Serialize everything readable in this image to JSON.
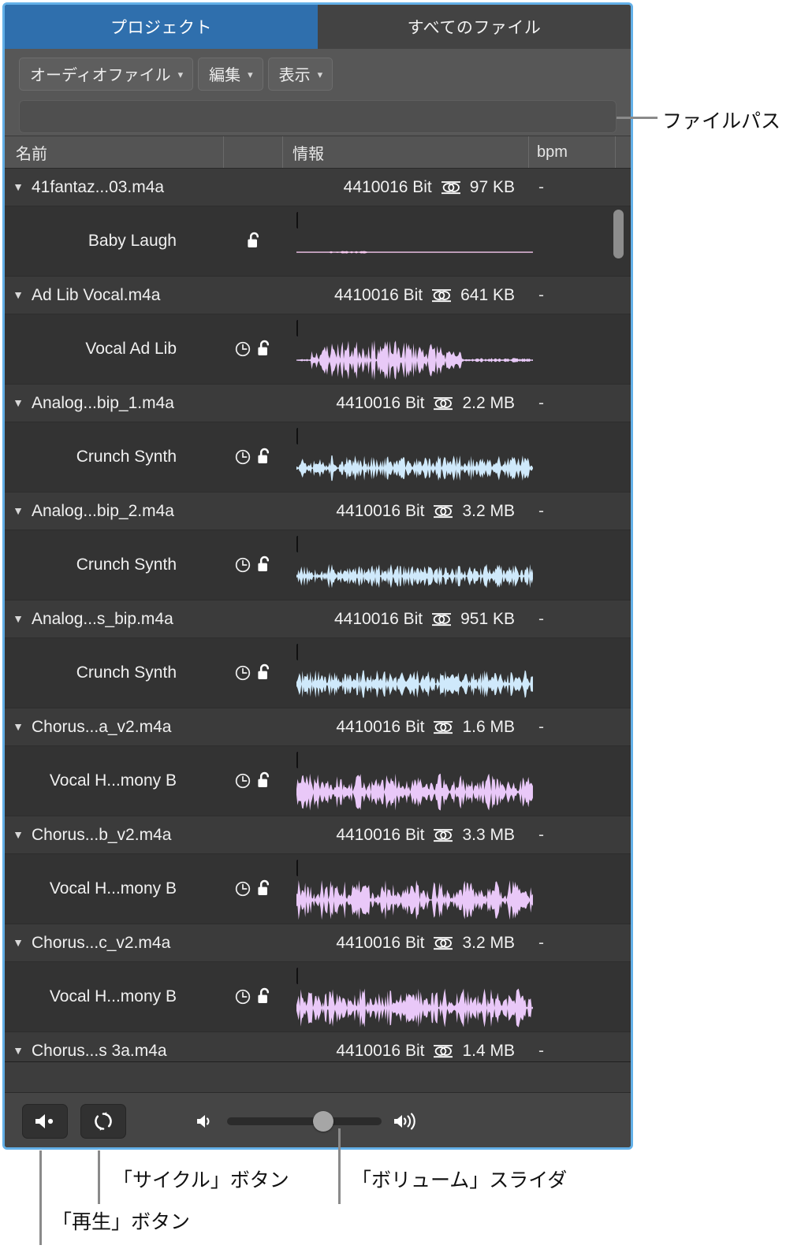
{
  "window": {
    "border_color": "#63b0e8",
    "tabs": [
      {
        "label": "プロジェクト",
        "active": true
      },
      {
        "label": "すべてのファイル",
        "active": false
      }
    ]
  },
  "menu_bar": {
    "items": [
      {
        "label": "オーディオファイル",
        "chevron": "chevron-down-icon"
      },
      {
        "label": "編集",
        "chevron": "chevron-down-icon"
      },
      {
        "label": "表示",
        "chevron": "chevron-down-icon"
      }
    ]
  },
  "file_path_field": {
    "value": "",
    "placeholder": ""
  },
  "columns": [
    {
      "key": "name",
      "label": "名前"
    },
    {
      "key": "icons",
      "label": ""
    },
    {
      "key": "info",
      "label": "情報"
    },
    {
      "key": "bpm",
      "label": "bpm"
    }
  ],
  "rows": [
    {
      "file": {
        "name": "41fantaz...03.m4a",
        "info": "4410016 Bit",
        "channel_icon": "stereo-icon",
        "size": "97 KB",
        "bpm": "-",
        "disclosure": "triangle-down-icon"
      },
      "region": {
        "name": "Baby Laugh",
        "has_clock": false,
        "has_lock": true,
        "clock_icon": "clock-icon",
        "lock_icon": "unlocked-padlock-icon",
        "anchor_icon": "anchor-icon",
        "wave_bg": "#b5239c",
        "wave_fg": "#f6c8ef",
        "wave_kind": "flat"
      }
    },
    {
      "file": {
        "name": "Ad Lib Vocal.m4a",
        "info": "4410016 Bit",
        "channel_icon": "stereo-icon",
        "size": "641 KB",
        "bpm": "-",
        "disclosure": "triangle-down-icon"
      },
      "region": {
        "name": "Vocal Ad Lib",
        "has_clock": true,
        "has_lock": true,
        "clock_icon": "clock-icon",
        "lock_icon": "unlocked-padlock-icon",
        "anchor_icon": "anchor-icon",
        "wave_bg": "#7d35cf",
        "wave_fg": "#e8c9f7",
        "wave_kind": "swell"
      }
    },
    {
      "file": {
        "name": "Analog...bip_1.m4a",
        "info": "4410016 Bit",
        "channel_icon": "stereo-icon",
        "size": "2.2 MB",
        "bpm": "-",
        "disclosure": "triangle-down-icon"
      },
      "region": {
        "name": "Crunch Synth",
        "has_clock": true,
        "has_lock": true,
        "clock_icon": "clock-icon",
        "lock_icon": "unlocked-padlock-icon",
        "anchor_icon": "anchor-icon",
        "wave_bg": "#2a7fb0",
        "wave_fg": "#cfe9fb",
        "wave_kind": "dense1"
      }
    },
    {
      "file": {
        "name": "Analog...bip_2.m4a",
        "info": "4410016 Bit",
        "channel_icon": "stereo-icon",
        "size": "3.2 MB",
        "bpm": "-",
        "disclosure": "triangle-down-icon"
      },
      "region": {
        "name": "Crunch Synth",
        "has_clock": true,
        "has_lock": true,
        "clock_icon": "clock-icon",
        "lock_icon": "unlocked-padlock-icon",
        "anchor_icon": "anchor-icon",
        "wave_bg": "#2a7fb0",
        "wave_fg": "#cfe9fb",
        "wave_kind": "dense2"
      }
    },
    {
      "file": {
        "name": "Analog...s_bip.m4a",
        "info": "4410016 Bit",
        "channel_icon": "stereo-icon",
        "size": "951 KB",
        "bpm": "-",
        "disclosure": "triangle-down-icon"
      },
      "region": {
        "name": "Crunch Synth",
        "has_clock": true,
        "has_lock": true,
        "clock_icon": "clock-icon",
        "lock_icon": "unlocked-padlock-icon",
        "anchor_icon": "anchor-icon",
        "wave_bg": "#2a7fb0",
        "wave_fg": "#cfe9fb",
        "wave_kind": "dense3"
      }
    },
    {
      "file": {
        "name": "Chorus...a_v2.m4a",
        "info": "4410016 Bit",
        "channel_icon": "stereo-icon",
        "size": "1.6 MB",
        "bpm": "-",
        "disclosure": "triangle-down-icon"
      },
      "region": {
        "name": "Vocal H...mony B",
        "has_clock": true,
        "has_lock": true,
        "clock_icon": "clock-icon",
        "lock_icon": "unlocked-padlock-icon",
        "anchor_icon": "anchor-icon",
        "wave_bg": "#8e33c9",
        "wave_fg": "#e9c8f8",
        "wave_kind": "vocal1"
      }
    },
    {
      "file": {
        "name": "Chorus...b_v2.m4a",
        "info": "4410016 Bit",
        "channel_icon": "stereo-icon",
        "size": "3.3 MB",
        "bpm": "-",
        "disclosure": "triangle-down-icon"
      },
      "region": {
        "name": "Vocal H...mony B",
        "has_clock": true,
        "has_lock": true,
        "clock_icon": "clock-icon",
        "lock_icon": "unlocked-padlock-icon",
        "anchor_icon": "anchor-icon",
        "wave_bg": "#8e33c9",
        "wave_fg": "#e9c8f8",
        "wave_kind": "vocal2"
      }
    },
    {
      "file": {
        "name": "Chorus...c_v2.m4a",
        "info": "4410016 Bit",
        "channel_icon": "stereo-icon",
        "size": "3.2 MB",
        "bpm": "-",
        "disclosure": "triangle-down-icon"
      },
      "region": {
        "name": "Vocal H...mony B",
        "has_clock": true,
        "has_lock": true,
        "clock_icon": "clock-icon",
        "lock_icon": "unlocked-padlock-icon",
        "anchor_icon": "anchor-icon",
        "wave_bg": "#8e33c9",
        "wave_fg": "#e9c8f8",
        "wave_kind": "vocal3"
      }
    },
    {
      "file": {
        "name": "Chorus...s 3a.m4a",
        "info": "4410016 Bit",
        "channel_icon": "stereo-icon",
        "size": "1.4 MB",
        "bpm": "-",
        "disclosure": "triangle-down-icon"
      },
      "region": {
        "name": "",
        "has_clock": false,
        "has_lock": false,
        "clock_icon": "clock-icon",
        "lock_icon": "unlocked-padlock-icon",
        "anchor_icon": "anchor-icon",
        "wave_bg": "#8e33c9",
        "wave_fg": "#e9c8f8",
        "wave_kind": "vocal1",
        "clipped": true
      }
    }
  ],
  "transport": {
    "play_button": {
      "icon": "speaker-play-icon",
      "label": ""
    },
    "cycle_button": {
      "icon": "cycle-loop-icon",
      "label": ""
    },
    "volume": {
      "low_icon": "speaker-low-icon",
      "high_icon": "speaker-high-icon",
      "value_percent": 64
    }
  },
  "callouts": [
    {
      "id": "file-path",
      "text": "ファイルパス"
    },
    {
      "id": "cycle-button",
      "text": "「サイクル」ボタン"
    },
    {
      "id": "volume-slider",
      "text": "「ボリューム」スライダ"
    },
    {
      "id": "play-button",
      "text": "「再生」ボタン"
    }
  ]
}
